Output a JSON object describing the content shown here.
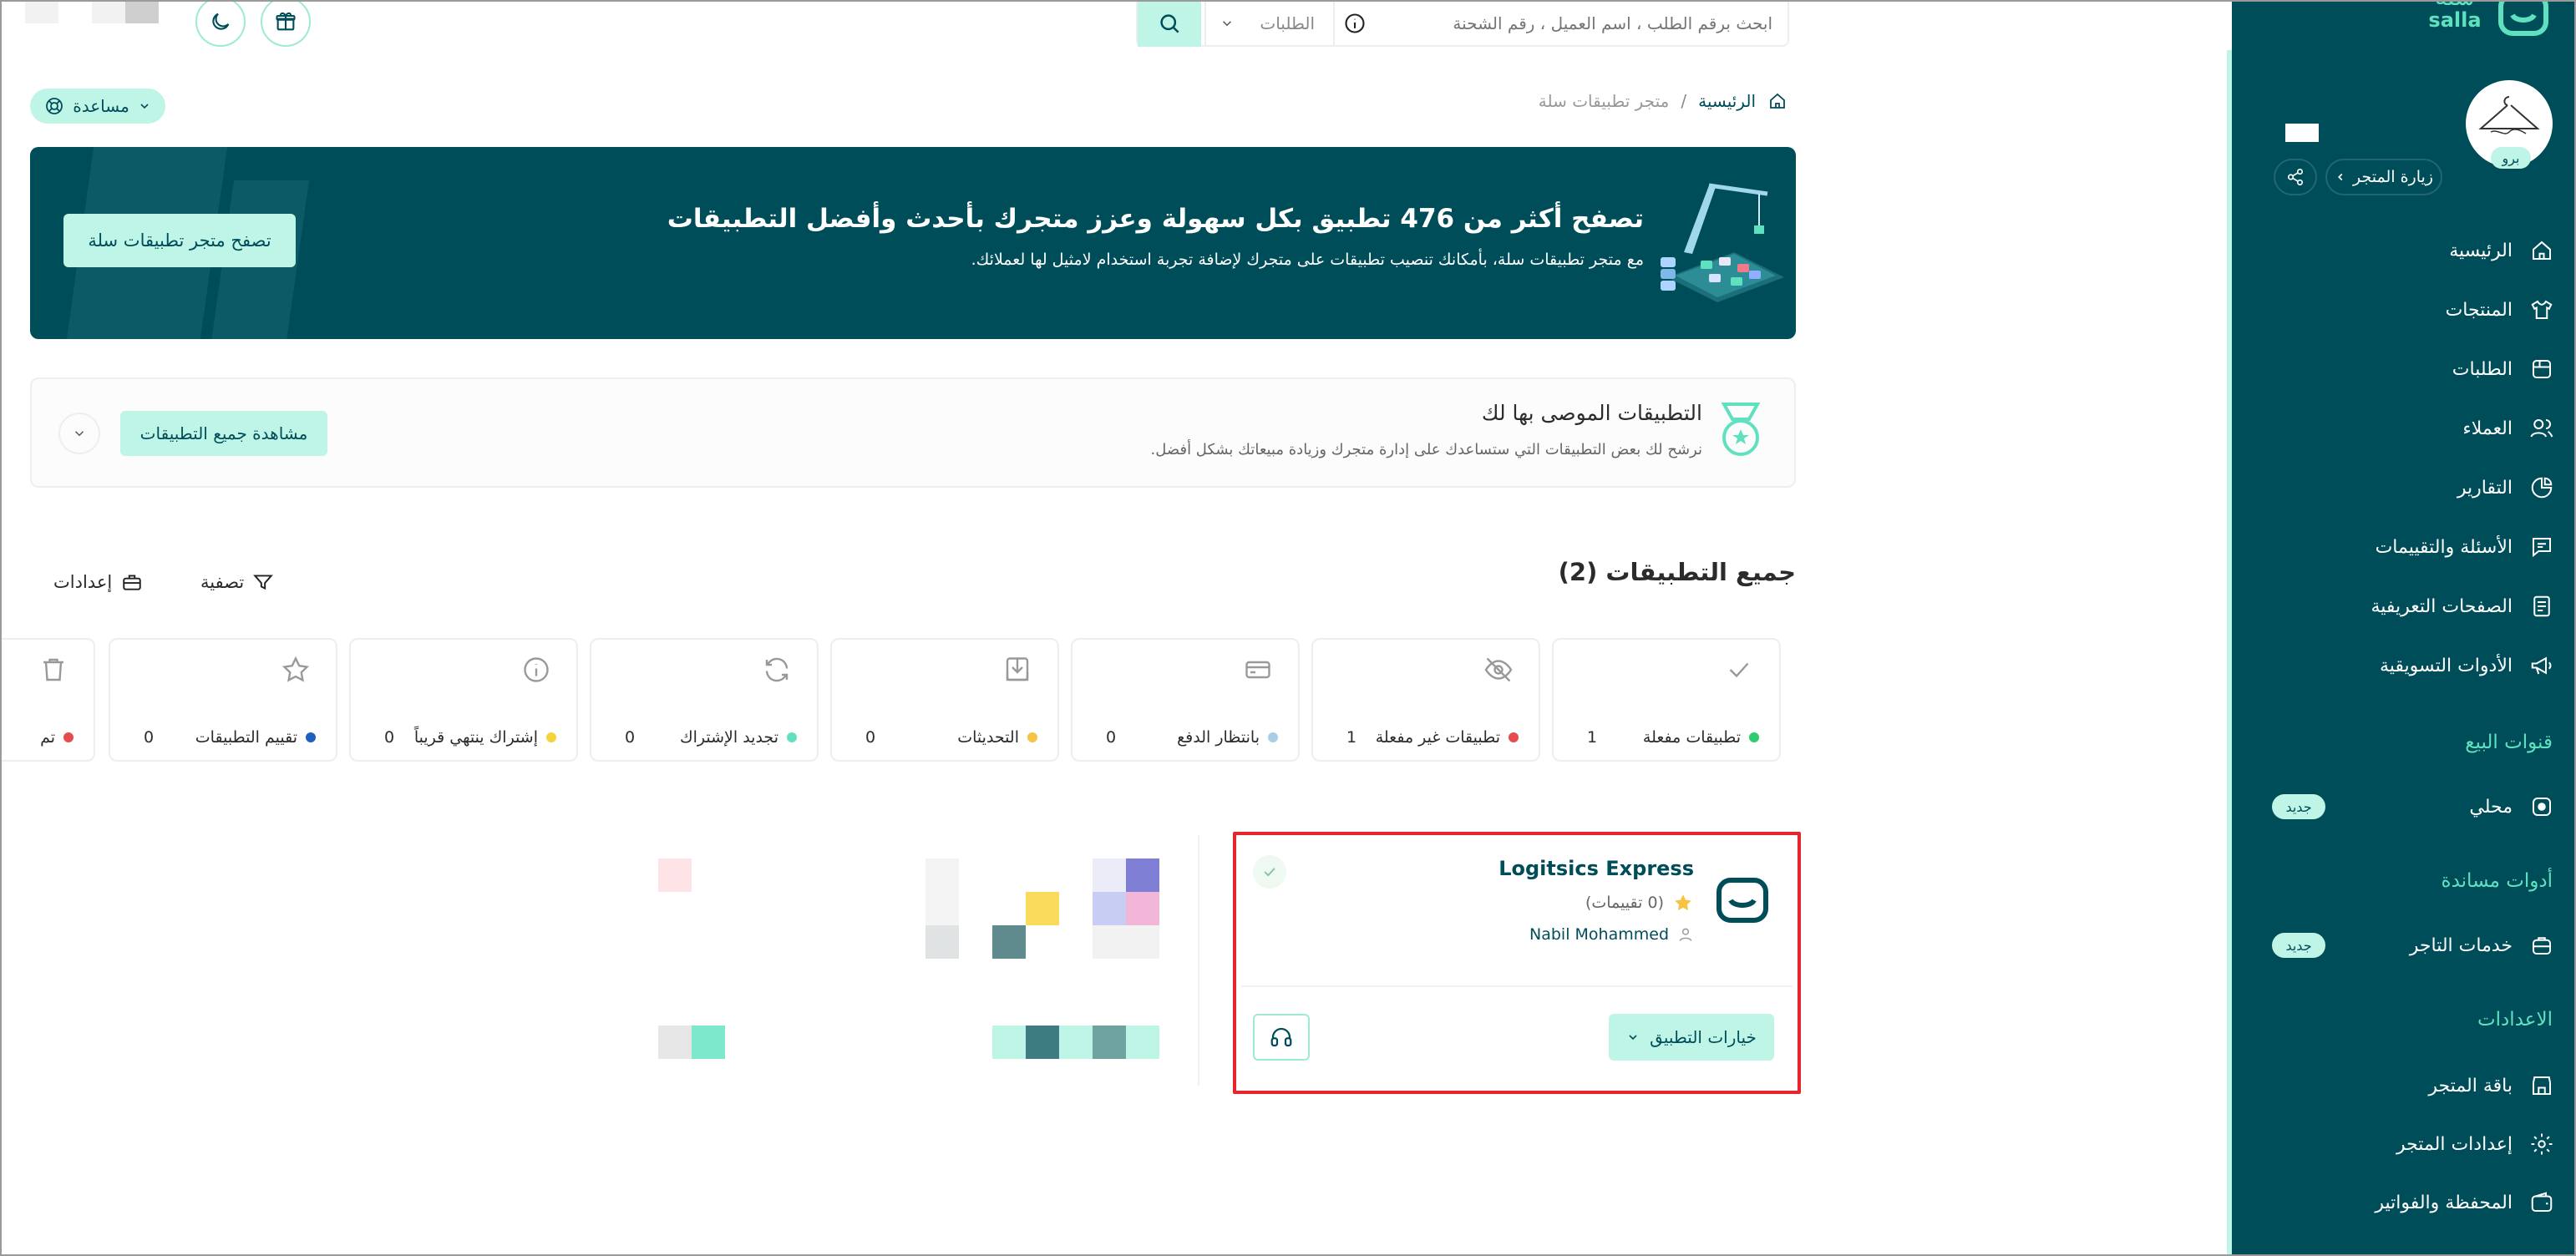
{
  "sidebar": {
    "brand": {
      "arabic": "سلة",
      "latin": "salla"
    },
    "store": {
      "plan_badge": "برو",
      "visit_store": "زيارة المتجر"
    },
    "items": [
      {
        "label": "الرئيسية",
        "icon": "home-icon"
      },
      {
        "label": "المنتجات",
        "icon": "shirt-icon"
      },
      {
        "label": "الطلبات",
        "icon": "orders-icon"
      },
      {
        "label": "العملاء",
        "icon": "users-icon"
      },
      {
        "label": "التقارير",
        "icon": "pie-chart-icon"
      },
      {
        "label": "الأسئلة والتقييمات",
        "icon": "message-icon"
      },
      {
        "label": "الصفحات التعريفية",
        "icon": "pages-icon"
      },
      {
        "label": "الأدوات التسويقية",
        "icon": "megaphone-icon"
      }
    ],
    "sections": {
      "sales_channels": "قنوات البيع",
      "support_tools": "أدوات مساندة",
      "settings": "الاعدادات"
    },
    "local": {
      "label": "محلي",
      "badge": "جديد"
    },
    "merchant_services": {
      "label": "خدمات التاجر",
      "badge": "جديد"
    },
    "settings_items": [
      {
        "label": "باقة المتجر",
        "icon": "store-package-icon"
      },
      {
        "label": "إعدادات المتجر",
        "icon": "gear-icon"
      },
      {
        "label": "المحفظة والفواتير",
        "icon": "wallet-icon"
      }
    ]
  },
  "topbar": {
    "search_placeholder": "ابحث برقم الطلب ، اسم العميل ، رقم الشحنة",
    "search_scope": "الطلبات"
  },
  "help": {
    "label": "مساعدة"
  },
  "breadcrumb": {
    "home": "الرئيسية",
    "separator": "/",
    "current": "متجر تطبيقات سلة"
  },
  "banner": {
    "title": "تصفح أكثر من 476 تطبيق بكل سهولة وعزز متجرك بأحدث وأفضل التطبيقات",
    "subtitle": "مع متجر تطبيقات سلة، بأمكانك تنصيب تطبيقات على متجرك لإضافة تجربة استخدام لامثيل لها لعملائك.",
    "button": "تصفح متجر تطبيقات سلة"
  },
  "recommended": {
    "title": "التطبيقات الموصى بها لك",
    "subtitle": "نرشح لك بعض التطبيقات التي ستساعدك على إدارة متجرك وزيادة مبيعاتك بشكل أفضل.",
    "button": "مشاهدة جميع التطبيقات"
  },
  "all_apps": {
    "title": "جميع التطبيقات (2)",
    "filter": "تصفية",
    "settings": "إعدادات"
  },
  "stats": [
    {
      "label": "تطبيقات مفعلة",
      "count": "1",
      "color": "#2ecc71",
      "icon": "check-icon"
    },
    {
      "label": "تطبيقات غير مفعلة",
      "count": "1",
      "color": "#e74c4c",
      "icon": "eye-off-icon"
    },
    {
      "label": "بانتظار الدفع",
      "count": "0",
      "color": "#a8cfe6",
      "icon": "payment-card-icon"
    },
    {
      "label": "التحديثات",
      "count": "0",
      "color": "#f6c342",
      "icon": "download-icon"
    },
    {
      "label": "تجديد الإشتراك",
      "count": "0",
      "color": "#5fe1c0",
      "icon": "refresh-icon"
    },
    {
      "label": "إشتراك ينتهي قريباً",
      "count": "0",
      "color": "#f6d33a",
      "icon": "info-icon"
    },
    {
      "label": "تقييم التطبيقات",
      "count": "0",
      "color": "#1f5fbf",
      "icon": "star-icon"
    },
    {
      "label": "تم",
      "count": "",
      "color": "#e74c4c",
      "icon": "trash-icon"
    }
  ],
  "app_card": {
    "name": "Logitsics Express",
    "rating_text": "(0 تقييمات)",
    "developer": "Nabil Mohammed",
    "options_button": "خيارات التطبيق"
  },
  "colors": {
    "sidebar_bg": "#004d5a",
    "mint": "#bff5e6",
    "accent_green": "#5fe1c0",
    "highlight_red": "#e8232e"
  }
}
